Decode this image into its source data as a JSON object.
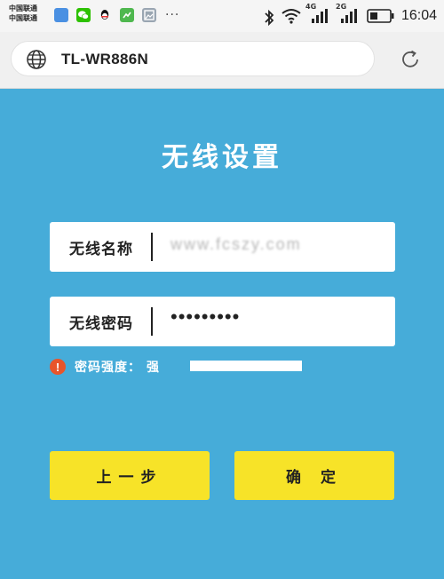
{
  "status_bar": {
    "carrier_line1": "中国联通",
    "carrier_line2": "中国联通",
    "more": "···",
    "net1": "4G",
    "net2": "2G",
    "time": "16:04",
    "icons": [
      "app-blue-icon",
      "wechat-icon",
      "qq-icon",
      "app-green-icon",
      "gallery-icon",
      "bluetooth-icon",
      "wifi-icon",
      "signal-icon",
      "signal-icon",
      "battery-icon"
    ]
  },
  "address_bar": {
    "url": "TL-WR886N",
    "icons": [
      "globe-icon",
      "refresh-icon"
    ]
  },
  "page": {
    "title": "无线设置",
    "ssid": {
      "label": "无线名称",
      "value": "www.fcszy.com"
    },
    "password": {
      "label": "无线密码",
      "value": "•••••••••"
    },
    "strength": {
      "label": "密码强度：",
      "value": "强",
      "level": 1.0
    },
    "buttons": {
      "prev": "上一步",
      "ok": "确 定"
    }
  },
  "colors": {
    "background": "#46acd9",
    "button": "#f7e328",
    "warning": "#e8552b"
  }
}
